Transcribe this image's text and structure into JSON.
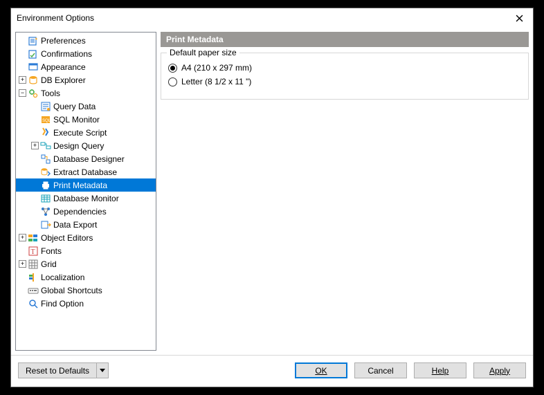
{
  "window": {
    "title": "Environment Options"
  },
  "tree": [
    {
      "label": "Preferences",
      "depth": 0,
      "expander": null,
      "icon": "prefs",
      "selected": false
    },
    {
      "label": "Confirmations",
      "depth": 0,
      "expander": null,
      "icon": "confirm",
      "selected": false
    },
    {
      "label": "Appearance",
      "depth": 0,
      "expander": null,
      "icon": "appear",
      "selected": false
    },
    {
      "label": "DB Explorer",
      "depth": 0,
      "expander": "plus",
      "icon": "db",
      "selected": false
    },
    {
      "label": "Tools",
      "depth": 0,
      "expander": "minus",
      "icon": "tools",
      "selected": false
    },
    {
      "label": "Query Data",
      "depth": 1,
      "expander": null,
      "icon": "query",
      "selected": false
    },
    {
      "label": "SQL Monitor",
      "depth": 1,
      "expander": null,
      "icon": "sqlmon",
      "selected": false
    },
    {
      "label": "Execute Script",
      "depth": 1,
      "expander": null,
      "icon": "exec",
      "selected": false
    },
    {
      "label": "Design Query",
      "depth": 1,
      "expander": "plus",
      "icon": "design",
      "selected": false
    },
    {
      "label": "Database Designer",
      "depth": 1,
      "expander": null,
      "icon": "dbdes",
      "selected": false
    },
    {
      "label": "Extract Database",
      "depth": 1,
      "expander": null,
      "icon": "extract",
      "selected": false
    },
    {
      "label": "Print Metadata",
      "depth": 1,
      "expander": null,
      "icon": "print",
      "selected": true
    },
    {
      "label": "Database Monitor",
      "depth": 1,
      "expander": null,
      "icon": "dbmon",
      "selected": false
    },
    {
      "label": "Dependencies",
      "depth": 1,
      "expander": null,
      "icon": "deps",
      "selected": false
    },
    {
      "label": "Data Export",
      "depth": 1,
      "expander": null,
      "icon": "export",
      "selected": false
    },
    {
      "label": "Object Editors",
      "depth": 0,
      "expander": "plus",
      "icon": "objed",
      "selected": false
    },
    {
      "label": "Fonts",
      "depth": 0,
      "expander": null,
      "icon": "fonts",
      "selected": false
    },
    {
      "label": "Grid",
      "depth": 0,
      "expander": "plus",
      "icon": "grid",
      "selected": false
    },
    {
      "label": "Localization",
      "depth": 0,
      "expander": null,
      "icon": "local",
      "selected": false
    },
    {
      "label": "Global Shortcuts",
      "depth": 0,
      "expander": null,
      "icon": "short",
      "selected": false
    },
    {
      "label": "Find Option",
      "depth": 0,
      "expander": null,
      "icon": "find",
      "selected": false
    }
  ],
  "section": {
    "title": "Print Metadata",
    "groupTitle": "Default paper size",
    "options": [
      {
        "label": "A4 (210 x 297 mm)",
        "checked": true
      },
      {
        "label": "Letter (8 1/2 x 11 \")",
        "checked": false
      }
    ]
  },
  "buttons": {
    "reset": "Reset to Defaults",
    "ok": "OK",
    "cancel": "Cancel",
    "help": "Help",
    "apply": "Apply"
  }
}
